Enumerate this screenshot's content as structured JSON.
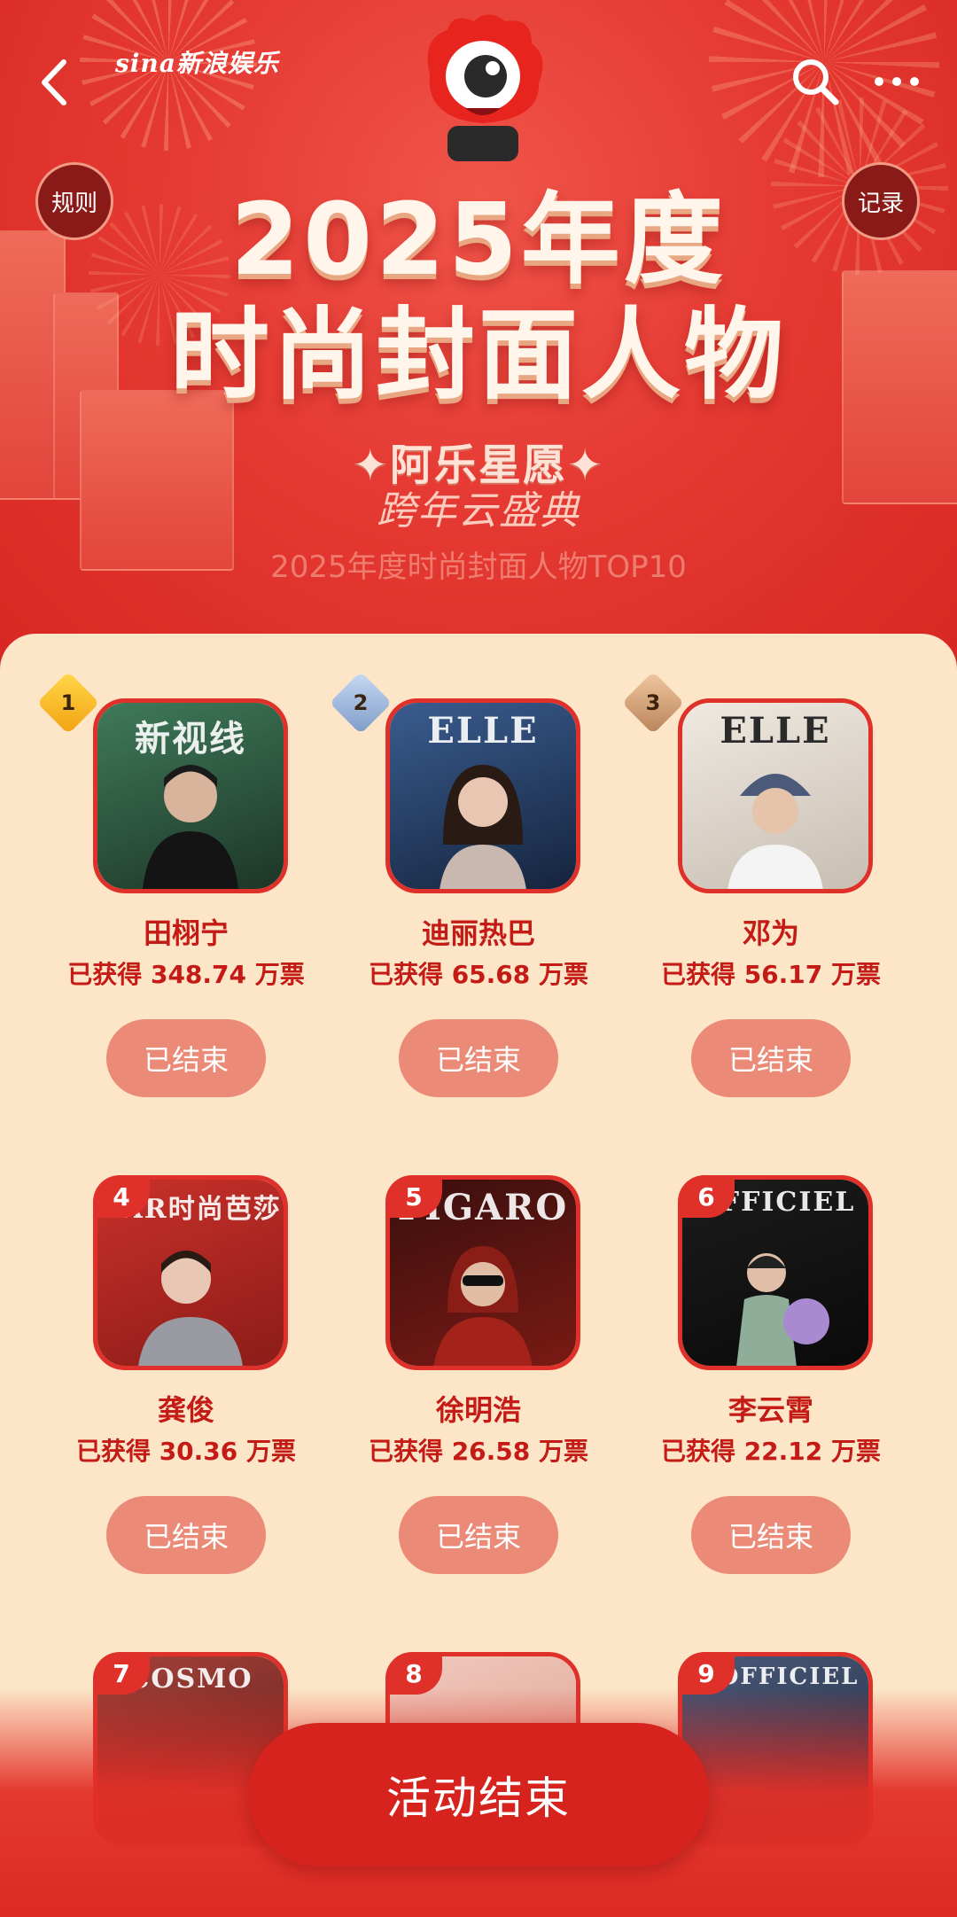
{
  "header": {
    "brand": "sina新浪娱乐",
    "rules_label": "规则",
    "records_label": "记录",
    "title_line1": "2025年度",
    "title_line2": "时尚封面人物",
    "subtitle_line1": "✦阿乐星愿✦",
    "subtitle_line2": "跨年云盛典",
    "faded_caption": "2025年度时尚封面人物TOP10"
  },
  "candidates": [
    {
      "rank": "1",
      "name": "田栩宁",
      "votes": "已获得 348.74 万票",
      "button": "已结束",
      "magazine": "新视线",
      "color": "#2f5a45"
    },
    {
      "rank": "2",
      "name": "迪丽热巴",
      "votes": "已获得 65.68 万票",
      "button": "已结束",
      "magazine": "ELLE",
      "color": "#1f3c6a"
    },
    {
      "rank": "3",
      "name": "邓为",
      "votes": "已获得 56.17 万票",
      "button": "已结束",
      "magazine": "ELLE",
      "color": "#d9d2c8"
    },
    {
      "rank": "4",
      "name": "龚俊",
      "votes": "已获得 30.36 万票",
      "button": "已结束",
      "magazine": "AAR时尚芭莎",
      "color": "#b3261f"
    },
    {
      "rank": "5",
      "name": "徐明浩",
      "votes": "已获得 26.58 万票",
      "button": "已结束",
      "magazine": "FIGARO",
      "color": "#5a1512"
    },
    {
      "rank": "6",
      "name": "李云霄",
      "votes": "已获得 22.12 万票",
      "button": "已结束",
      "magazine": "OFFICIEL",
      "color": "#1a1a1a"
    },
    {
      "rank": "7",
      "name": "",
      "votes": "",
      "button": "",
      "magazine": "COSMO",
      "color": "#8a2a2a"
    },
    {
      "rank": "8",
      "name": "",
      "votes": "",
      "button": "",
      "magazine": "",
      "color": "#e8b5a8"
    },
    {
      "rank": "9",
      "name": "",
      "votes": "",
      "button": "",
      "magazine": "L'OFFICIEL",
      "color": "#2a3a5a"
    }
  ],
  "footer": {
    "action_label": "活动结束"
  },
  "colors": {
    "primary_red": "#e0302a",
    "panel_bg": "#fde6c8",
    "ended_button": "#eb8a77",
    "gold_badge": "#f6b92a",
    "silver_badge": "#9ab3d8",
    "bronze_badge": "#d9a87c"
  },
  "icons": [
    "back-arrow-icon",
    "search-icon",
    "more-icon",
    "mascot-eye-icon"
  ]
}
